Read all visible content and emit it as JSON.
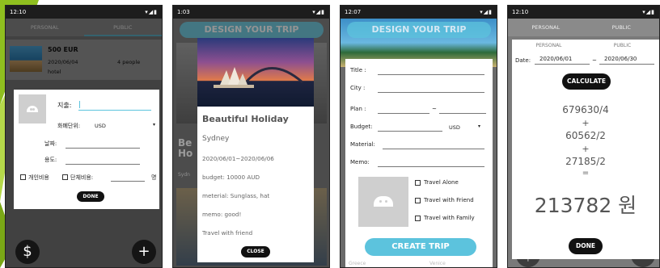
{
  "status": {
    "time1": "12:10",
    "time2": "1:03",
    "time3": "12:07",
    "time4": "12:10",
    "icons": "▾◢▮"
  },
  "screen1": {
    "tabs": [
      "PERSONAL",
      "PUBLIC"
    ],
    "list_item": {
      "price": "500 EUR",
      "date": "2020/06/04",
      "people": "4 people",
      "type": "hotel"
    },
    "dialog": {
      "expense_label": "지출:",
      "currency_label": "화폐단위:",
      "currency_value": "USD",
      "date_label": "날짜:",
      "purpose_label": "용도:",
      "personal_label": "개인비용",
      "group_label": "단체비용:",
      "unit_label": "명",
      "done": "DONE"
    },
    "fab_left": "$",
    "fab_right": "+"
  },
  "screen2": {
    "header": "DESIGN YOUR TRIP",
    "bg_text": "Be Ho",
    "bg_small": "Sydn",
    "title": "Beautiful Holiday",
    "city": "Sydney",
    "dates": "2020/06/01~2020/06/06",
    "budget": "budget: 10000 AUD",
    "material": "meterial: Sunglass, hat",
    "memo": "memo: good!",
    "travel": "Travel with friend",
    "close": "CLOSE"
  },
  "screen3": {
    "header": "DESIGN YOUR TRIP",
    "title_label": "Title :",
    "city_label": "City :",
    "plan_label": "Plan :",
    "plan_sep": "~",
    "budget_label": "Budget:",
    "budget_currency": "USD",
    "material_label": "Material:",
    "memo_label": "Memo:",
    "options": [
      "Travel Alone",
      "Travel with Friend",
      "Travel with Family"
    ],
    "create": "CREATE TRIP",
    "bottom_left": "Greece",
    "bottom_right": "Venice"
  },
  "screen4": {
    "tabs": [
      "PERSONAL",
      "PUBLIC"
    ],
    "date_label": "Date:",
    "date_from": "2020/06/01",
    "date_sep": "~",
    "date_to": "2020/06/30",
    "calculate": "CALCULATE",
    "lines": [
      "679630/4",
      "+",
      "60562/2",
      "+",
      "27185/2",
      "="
    ],
    "result": "213782 원",
    "done": "DONE"
  },
  "colors": {
    "accent": "#5cc3dd",
    "deco_green": "#a6cf2a",
    "fab": "#151515"
  }
}
